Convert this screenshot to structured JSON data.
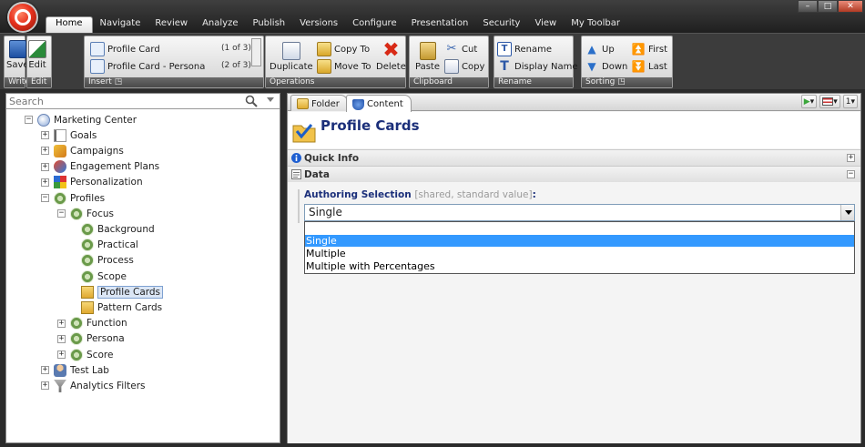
{
  "menu": {
    "tabs": [
      "Home",
      "Navigate",
      "Review",
      "Analyze",
      "Publish",
      "Versions",
      "Configure",
      "Presentation",
      "Security",
      "View",
      "My Toolbar"
    ],
    "active_tab": "Home"
  },
  "ribbon": {
    "write": {
      "save": "Save",
      "label": "Write"
    },
    "edit": {
      "edit": "Edit",
      "label": "Edit"
    },
    "insert": {
      "items": [
        {
          "label": "Profile Card",
          "count": "(1 of 3)"
        },
        {
          "label": "Profile Card - Persona",
          "count": "(2 of 3)"
        }
      ],
      "label": "Insert"
    },
    "operations": {
      "duplicate": "Duplicate",
      "copy_to": "Copy To",
      "move_to": "Move To",
      "delete": "Delete",
      "label": "Operations"
    },
    "clipboard": {
      "paste": "Paste",
      "cut": "Cut",
      "copy": "Copy",
      "label": "Clipboard"
    },
    "rename": {
      "rename": "Rename",
      "display_name": "Display Name",
      "label": "Rename"
    },
    "sorting": {
      "up": "Up",
      "down": "Down",
      "first": "First",
      "last": "Last",
      "label": "Sorting"
    }
  },
  "search": {
    "placeholder": "Search"
  },
  "tree": [
    {
      "label": "Marketing Center",
      "exp": "−",
      "icon": "globe-icon"
    },
    {
      "label": "Goals",
      "exp": "+",
      "icon": "flag-icon"
    },
    {
      "label": "Campaigns",
      "exp": "+",
      "icon": "campaign-icon"
    },
    {
      "label": "Engagement Plans",
      "exp": "+",
      "icon": "engagement-icon"
    },
    {
      "label": "Personalization",
      "exp": "+",
      "icon": "personalization-icon"
    },
    {
      "label": "Profiles",
      "exp": "−",
      "icon": "profile-icon"
    },
    {
      "label": "Focus",
      "exp": "−",
      "icon": "profile-icon"
    },
    {
      "label": "Background",
      "exp": "",
      "icon": "profile-icon"
    },
    {
      "label": "Practical",
      "exp": "",
      "icon": "profile-icon"
    },
    {
      "label": "Process",
      "exp": "",
      "icon": "profile-icon"
    },
    {
      "label": "Scope",
      "exp": "",
      "icon": "profile-icon"
    },
    {
      "label": "Profile Cards",
      "exp": "",
      "icon": "folder-check-icon"
    },
    {
      "label": "Pattern Cards",
      "exp": "",
      "icon": "folder-icon"
    },
    {
      "label": "Function",
      "exp": "+",
      "icon": "profile-icon"
    },
    {
      "label": "Persona",
      "exp": "+",
      "icon": "profile-icon"
    },
    {
      "label": "Score",
      "exp": "+",
      "icon": "profile-icon"
    },
    {
      "label": "Test Lab",
      "exp": "+",
      "icon": "user-icon"
    },
    {
      "label": "Analytics Filters",
      "exp": "+",
      "icon": "filter-icon"
    }
  ],
  "content": {
    "tabs": [
      "Folder",
      "Content"
    ],
    "active_tab": "Content",
    "title": "Profile Cards",
    "sections": {
      "quick_info": "Quick Info",
      "data": "Data"
    },
    "field": {
      "label": "Authoring Selection",
      "hint": "[shared, standard value]",
      "suffix": ":",
      "value": "Single",
      "options": [
        "Single",
        "Multiple",
        "Multiple with Percentages"
      ],
      "highlighted": "Single"
    },
    "tools": {
      "page": "1"
    }
  },
  "colors": {
    "accent": "#3399ff",
    "title": "#1b2f7a"
  }
}
